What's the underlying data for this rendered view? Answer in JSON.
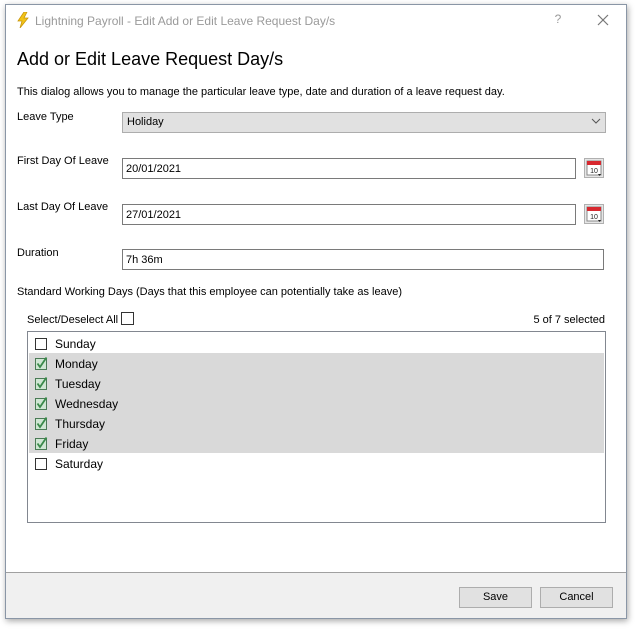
{
  "window": {
    "title": "Lightning Payroll - Edit Add or Edit Leave Request Day/s",
    "help_label": "?",
    "close_label": "✕"
  },
  "heading": "Add or Edit Leave Request Day/s",
  "description": "This dialog allows you to manage the particular leave type, date and duration of a leave request day.",
  "fields": {
    "leave_type": {
      "label": "Leave Type",
      "value": "Holiday"
    },
    "first_day": {
      "label": "First Day Of Leave",
      "value": "20/01/2021"
    },
    "last_day": {
      "label": "Last Day Of Leave",
      "value": "27/01/2021"
    },
    "duration": {
      "label": "Duration",
      "value": "7h 36m"
    }
  },
  "working_days": {
    "section_label": "Standard Working Days (Days that this employee can potentially take as leave)",
    "select_all_label": "Select/Deselect All",
    "select_all_checked": false,
    "count_text": "5 of 7 selected",
    "days": [
      {
        "label": "Sunday",
        "checked": false
      },
      {
        "label": "Monday",
        "checked": true
      },
      {
        "label": "Tuesday",
        "checked": true
      },
      {
        "label": "Wednesday",
        "checked": true
      },
      {
        "label": "Thursday",
        "checked": true
      },
      {
        "label": "Friday",
        "checked": true
      },
      {
        "label": "Saturday",
        "checked": false
      }
    ]
  },
  "footer": {
    "save_label": "Save",
    "cancel_label": "Cancel"
  },
  "colors": {
    "accent_lightning": "#f2c418",
    "calendar_red": "#d7282f",
    "check_green": "#3a8a4a"
  }
}
